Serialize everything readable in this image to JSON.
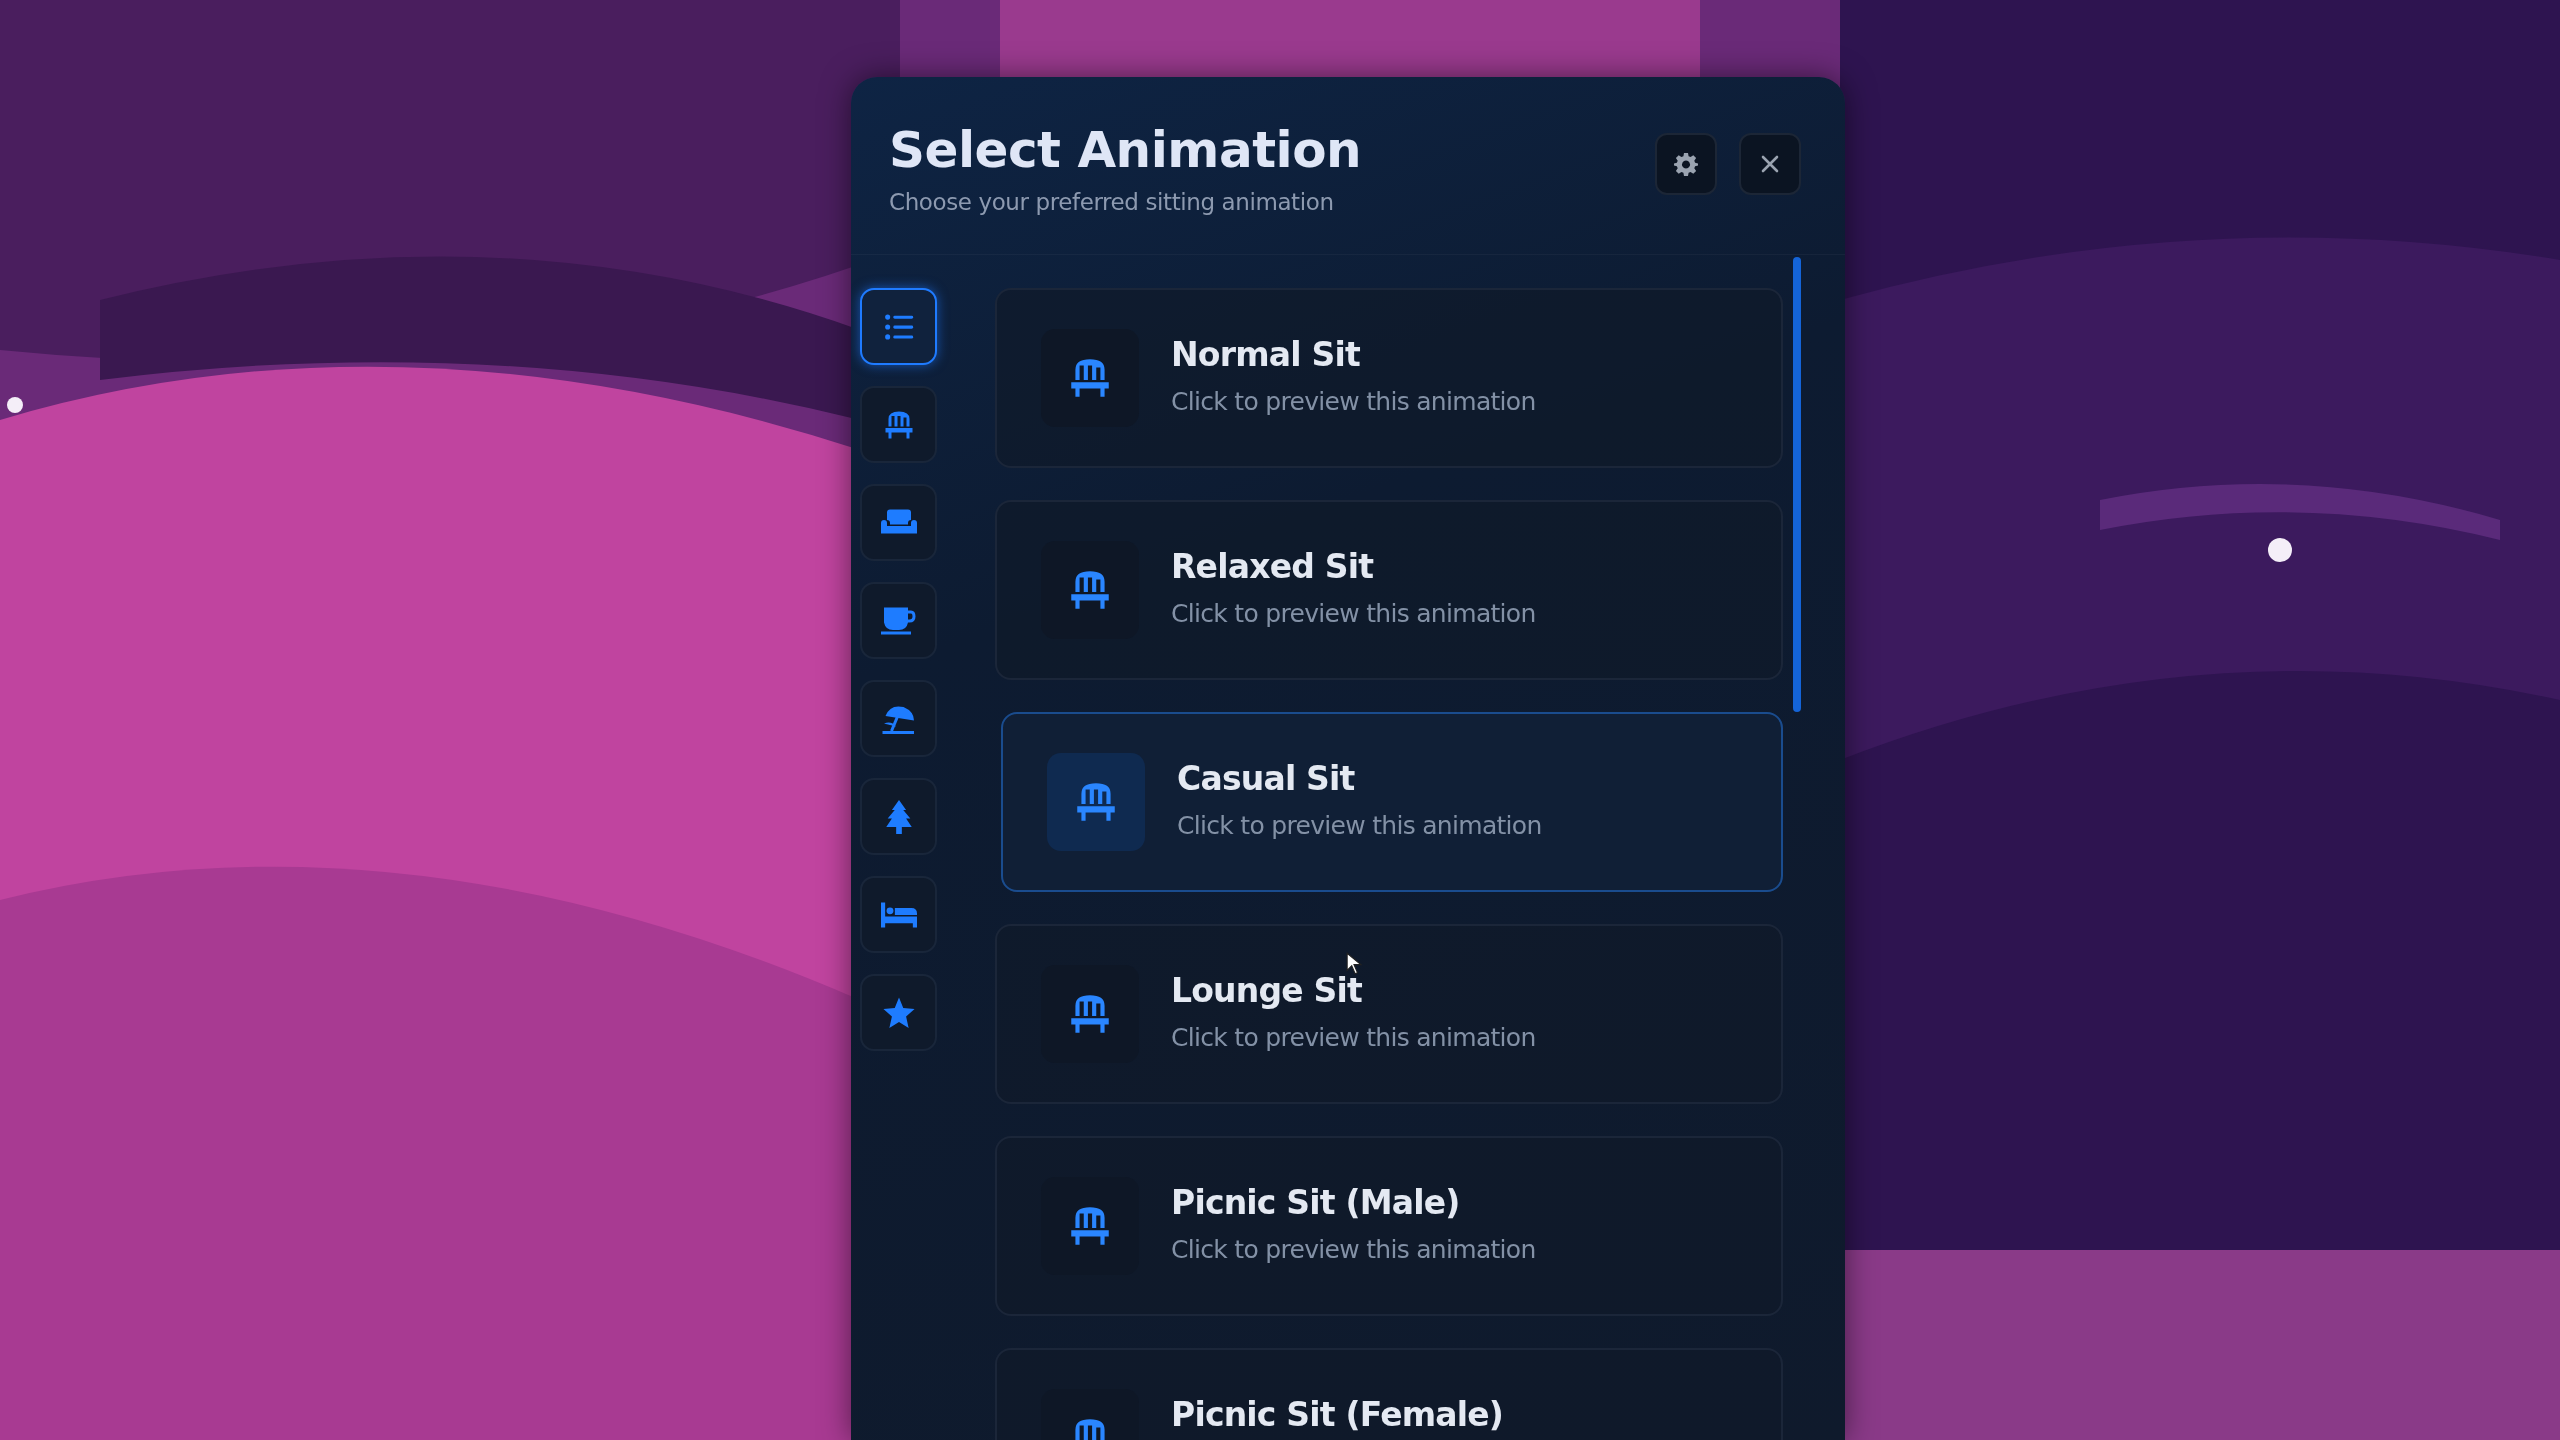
{
  "window": {
    "title": "Select Animation",
    "subtitle": "Choose your preferred sitting animation"
  },
  "header_buttons": [
    {
      "kind": "settings"
    },
    {
      "kind": "close"
    }
  ],
  "sidebar": {
    "items": [
      {
        "selected": true
      },
      {
        "selected": false
      },
      {
        "selected": false
      },
      {
        "selected": false
      },
      {
        "selected": false
      },
      {
        "selected": false
      },
      {
        "selected": false
      },
      {
        "selected": false
      }
    ]
  },
  "animations": [
    {
      "title": "Normal Sit",
      "description": "Click to preview this animation",
      "highlighted": false
    },
    {
      "title": "Relaxed Sit",
      "description": "Click to preview this animation",
      "highlighted": false
    },
    {
      "title": "Casual Sit",
      "description": "Click to preview this animation",
      "highlighted": true
    },
    {
      "title": "Lounge Sit",
      "description": "Click to preview this animation",
      "highlighted": false
    },
    {
      "title": "Picnic Sit (Male)",
      "description": "Click to preview this animation",
      "highlighted": false
    },
    {
      "title": "Picnic Sit (Female)",
      "highlighted": false
    }
  ]
}
